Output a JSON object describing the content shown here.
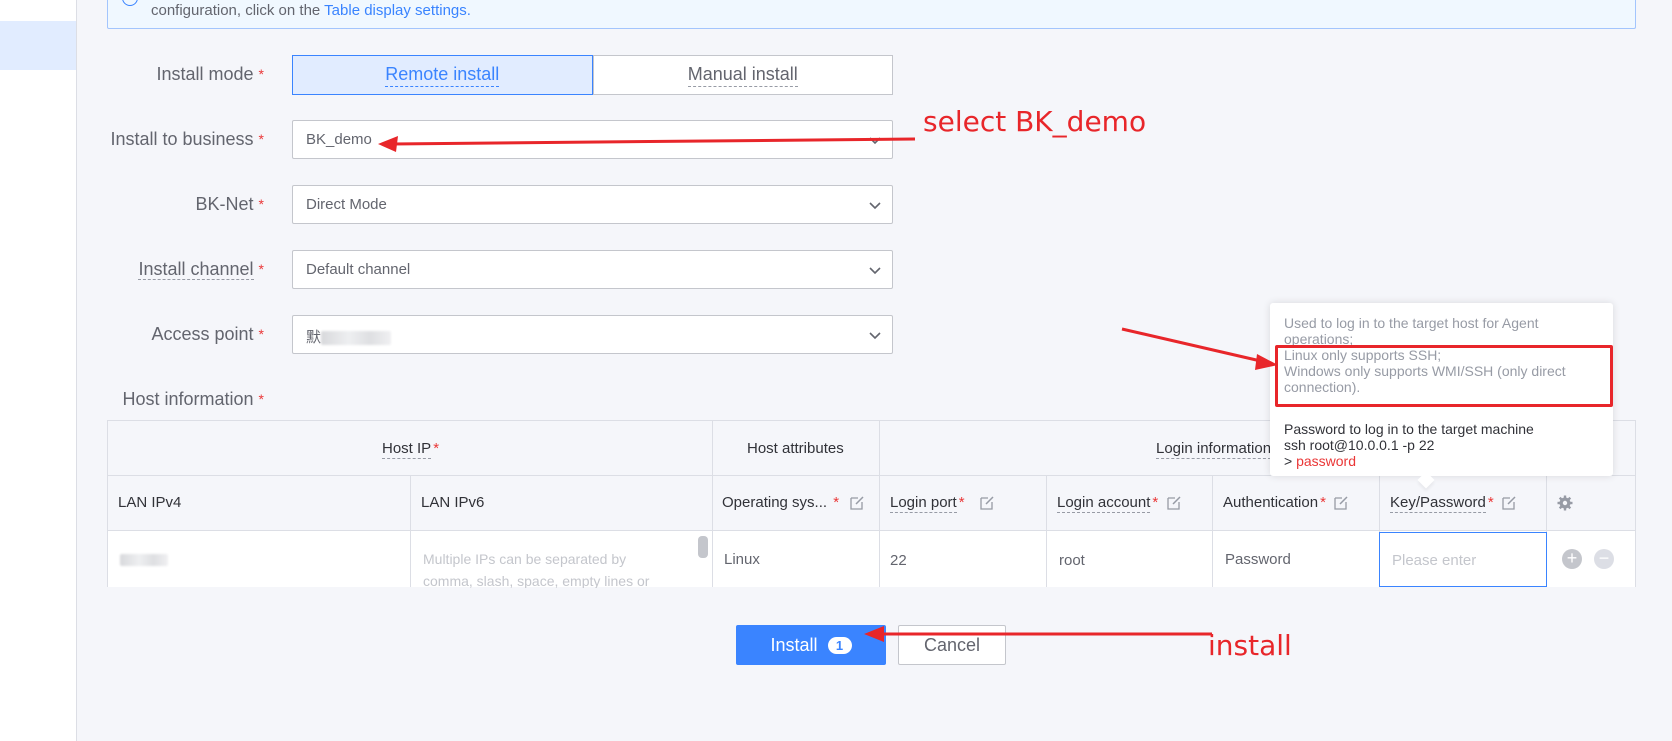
{
  "banner": {
    "text": "configuration, click on the",
    "link": "Table display settings."
  },
  "form": {
    "install_mode": {
      "label": "Install mode",
      "options": [
        "Remote install",
        "Manual install"
      ],
      "selected": "Remote install"
    },
    "business": {
      "label": "Install to business",
      "value": "BK_demo"
    },
    "bk_net": {
      "label": "BK-Net",
      "value": "Direct Mode"
    },
    "channel": {
      "label": "Install channel",
      "value": "Default channel"
    },
    "access_point": {
      "label": "Access point",
      "value": "默"
    },
    "host_info": {
      "label": "Host information"
    },
    "required_mark": "*"
  },
  "table": {
    "group_headers": {
      "host_ip": "Host IP",
      "host_attributes": "Host attributes",
      "login_information": "Login information"
    },
    "columns": {
      "lan_ipv4": "LAN IPv4",
      "lan_ipv6": "LAN IPv6",
      "os": "Operating sys...",
      "login_port": "Login port",
      "login_account": "Login account",
      "authentication": "Authentication",
      "key_password": "Key/Password"
    },
    "row": {
      "ipv6_placeholder_line1": "Multiple IPs can be separated by",
      "ipv6_placeholder_line2": "comma, slash, space, empty lines or",
      "os": "Linux",
      "login_port": "22",
      "login_account": "root",
      "authentication": "Password",
      "password_placeholder": "Please enter"
    }
  },
  "tooltip": {
    "line1": "Used to log in to the target host for Agent",
    "line2": "operations;",
    "line3": "Linux only supports SSH;",
    "line4": "Windows only supports WMI/SSH (only direct",
    "line5": "connection).",
    "line6": "Password to log in to the target machine",
    "line7": "ssh root@10.0.0.1 -p 22",
    "line8_prefix": ">",
    "line8_value": "password"
  },
  "actions": {
    "install_label": "Install",
    "install_count": "1",
    "cancel_label": "Cancel"
  },
  "annotations": {
    "select_business": "select BK_demo",
    "install": "install"
  },
  "colors": {
    "primary": "#3a84ff",
    "required": "#ea3636",
    "annotation": "#e8262a"
  }
}
